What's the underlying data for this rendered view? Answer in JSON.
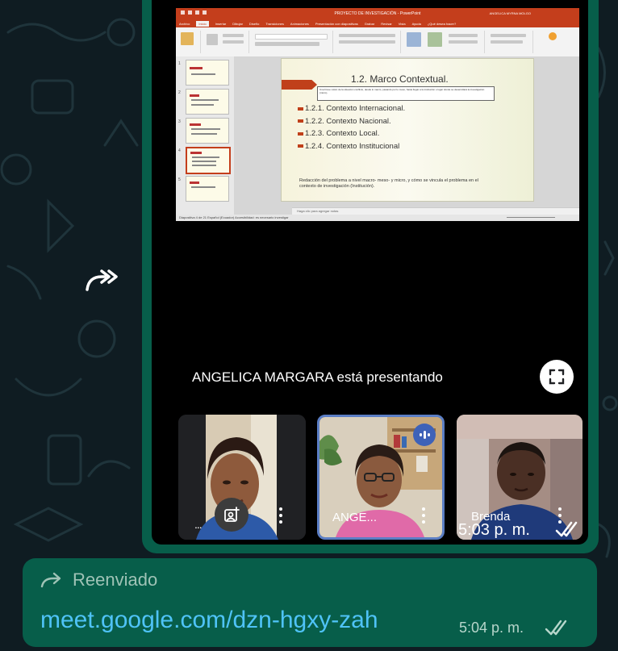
{
  "ppt": {
    "window_title": "PROYECTO DE INVESTIGACIÓN - PowerPoint",
    "user": "ANGELICA MYRNA MOLGO",
    "tabs": [
      "Archivo",
      "Inicio",
      "Insertar",
      "Dibujar",
      "Diseño",
      "Transiciones",
      "Animaciones",
      "Presentación con diapositivas",
      "Grabar",
      "Revisar",
      "Vista",
      "Ayuda",
      "¿Qué desea hacer?"
    ],
    "slide": {
      "title": "1.2. Marco Contextual.",
      "note": "Una breve visión de la situación conflicto, desde lo macro, pasando por lo meso, hasta llegar a la institución o lugar donde se desarrollará la investigación (micro).",
      "items": [
        "1.2.1. Contexto Internacional.",
        "1.2.2. Contexto Nacional.",
        "1.2.3. Contexto Local.",
        "1.2.4. Contexto Institucional"
      ],
      "footer": "Redacción del problema a nivel macro- meso- y micro, y cómo se vincula el problema en el contexto de investigación (Institución)."
    },
    "notes": "Haga clic para agregar notas",
    "status": "Diapositiva 4 de 21   Español (Ecuador)   Accesibilidad: es necesario investigar"
  },
  "call": {
    "presenting": "ANGELICA MARGARA está presentando",
    "tiles": [
      {
        "name": "..."
      },
      {
        "name": "ANGE..."
      },
      {
        "name": "Brenda"
      }
    ]
  },
  "media_message": {
    "time": "5:03 p. m."
  },
  "link_message": {
    "forwarded_label": "Reenviado",
    "link": "meet.google.com/dzn-hgxy-zah",
    "time": "5:04 p. m."
  },
  "colors": {
    "bubble": "#075e4a",
    "link": "#4fc3f7",
    "ppt_accent": "#c43e1c"
  }
}
